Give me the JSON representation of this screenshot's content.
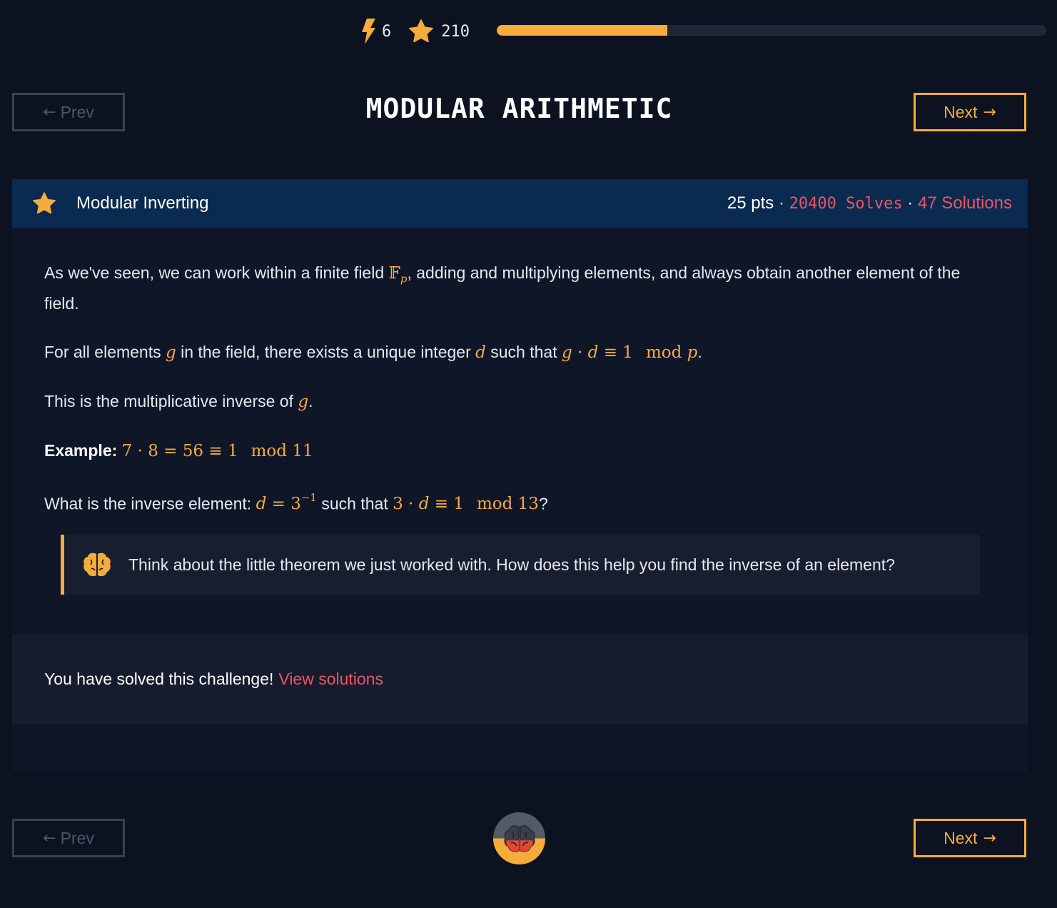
{
  "header": {
    "streak": "6",
    "score": "210",
    "progress_fraction": 0.31
  },
  "nav": {
    "prev_label": "Prev",
    "next_label": "Next",
    "prev_arrow": "←",
    "next_arrow": "→"
  },
  "page_title": "MODULAR ARITHMETIC",
  "challenge": {
    "name": "Modular Inverting",
    "points": "25 pts",
    "separator": " · ",
    "solves": "20400 Solves",
    "solutions": "47 Solutions"
  },
  "content": {
    "p1_a": "As we've seen, we can work within a finite field ",
    "p1_b": ", adding and multiplying elements, and always obtain another element of the field.",
    "p2_a": "For all elements ",
    "p2_b": " in the field, there exists a unique integer ",
    "p2_c": " such that ",
    "p3_a": "This is the multiplicative inverse of ",
    "example_label": "Example:",
    "q_a": "What is the inverse element: ",
    "q_b": " such that ",
    "q_end": "?"
  },
  "math": {
    "field": "𝔽",
    "field_sub": "p",
    "g": "g",
    "d": "d",
    "p": "p",
    "cdot": " · ",
    "equiv": " ≡ ",
    "eq": " = ",
    "one": "1",
    "mod": "mod",
    "seven": "7",
    "eight": "8",
    "fifty_six": "56",
    "eleven": "11",
    "three": "3",
    "minus_one": "−1",
    "thirteen": "13",
    "period": "."
  },
  "hint": {
    "text": "Think about the little theorem we just worked with. How does this help you find the inverse of an element?"
  },
  "solved": {
    "text": "You have solved this challenge!",
    "link": "View solutions"
  },
  "colors": {
    "accent": "#f6ac3a",
    "link_red": "#ee5464",
    "header_blue": "#0b2a4f",
    "background": "#0d1221"
  },
  "icons": {
    "streak": "lightning-bolt-icon",
    "score": "star-icon",
    "challenge": "star-icon",
    "hint": "brain-icon",
    "discuss": "brain-icon"
  }
}
